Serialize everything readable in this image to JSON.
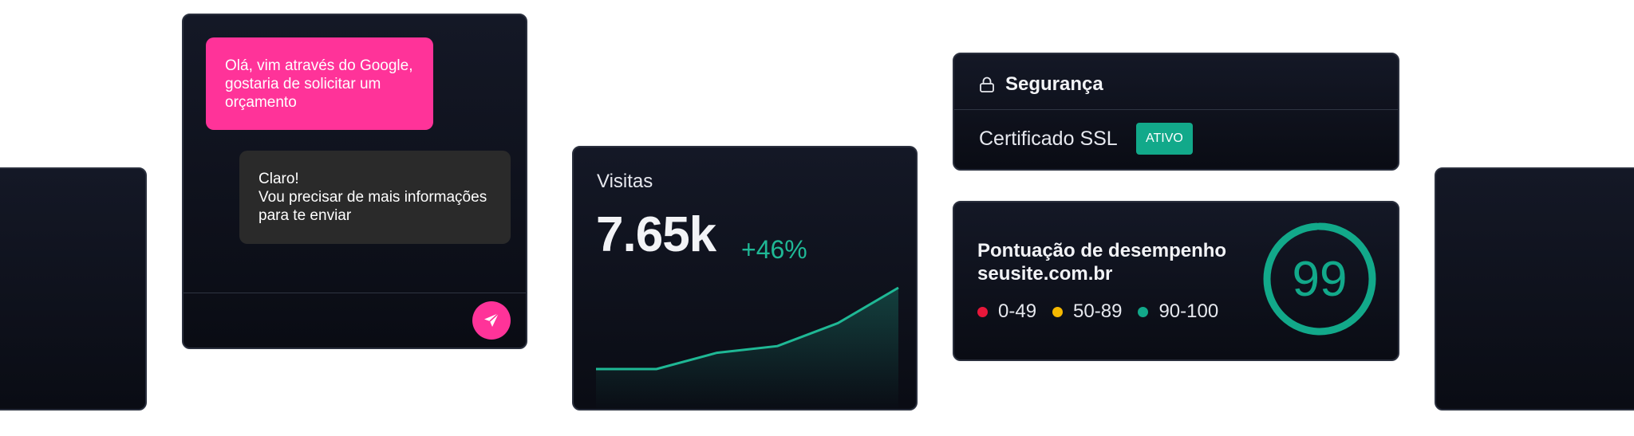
{
  "chat": {
    "user_message": "Olá, vim através do Google,\ngostaria de solicitar um\norçamento",
    "reply_message": "Claro!\nVou precisar de mais informações\npara te enviar",
    "send_icon": "paper-plane-icon",
    "accent_color": "#ff3399"
  },
  "visits": {
    "title": "Visitas",
    "value": "7.65k",
    "change": "+46%",
    "trend_color": "#1fb895",
    "trend": [
      0.0,
      0.0,
      0.17,
      0.24,
      0.48,
      0.85
    ]
  },
  "security": {
    "icon": "lock-icon",
    "title": "Segurança",
    "ssl_label": "Certificado SSL",
    "ssl_status": "ATIVO",
    "status_color": "#12a98a"
  },
  "performance": {
    "title_line1": "Pontuação de desempenho",
    "title_line2": "seusite.com.br",
    "score": "99",
    "score_color": "#12a98a",
    "legend": [
      {
        "label": "0-49",
        "color": "#e8173a"
      },
      {
        "label": "50-89",
        "color": "#f5b800"
      },
      {
        "label": "90-100",
        "color": "#12a98a"
      }
    ]
  }
}
